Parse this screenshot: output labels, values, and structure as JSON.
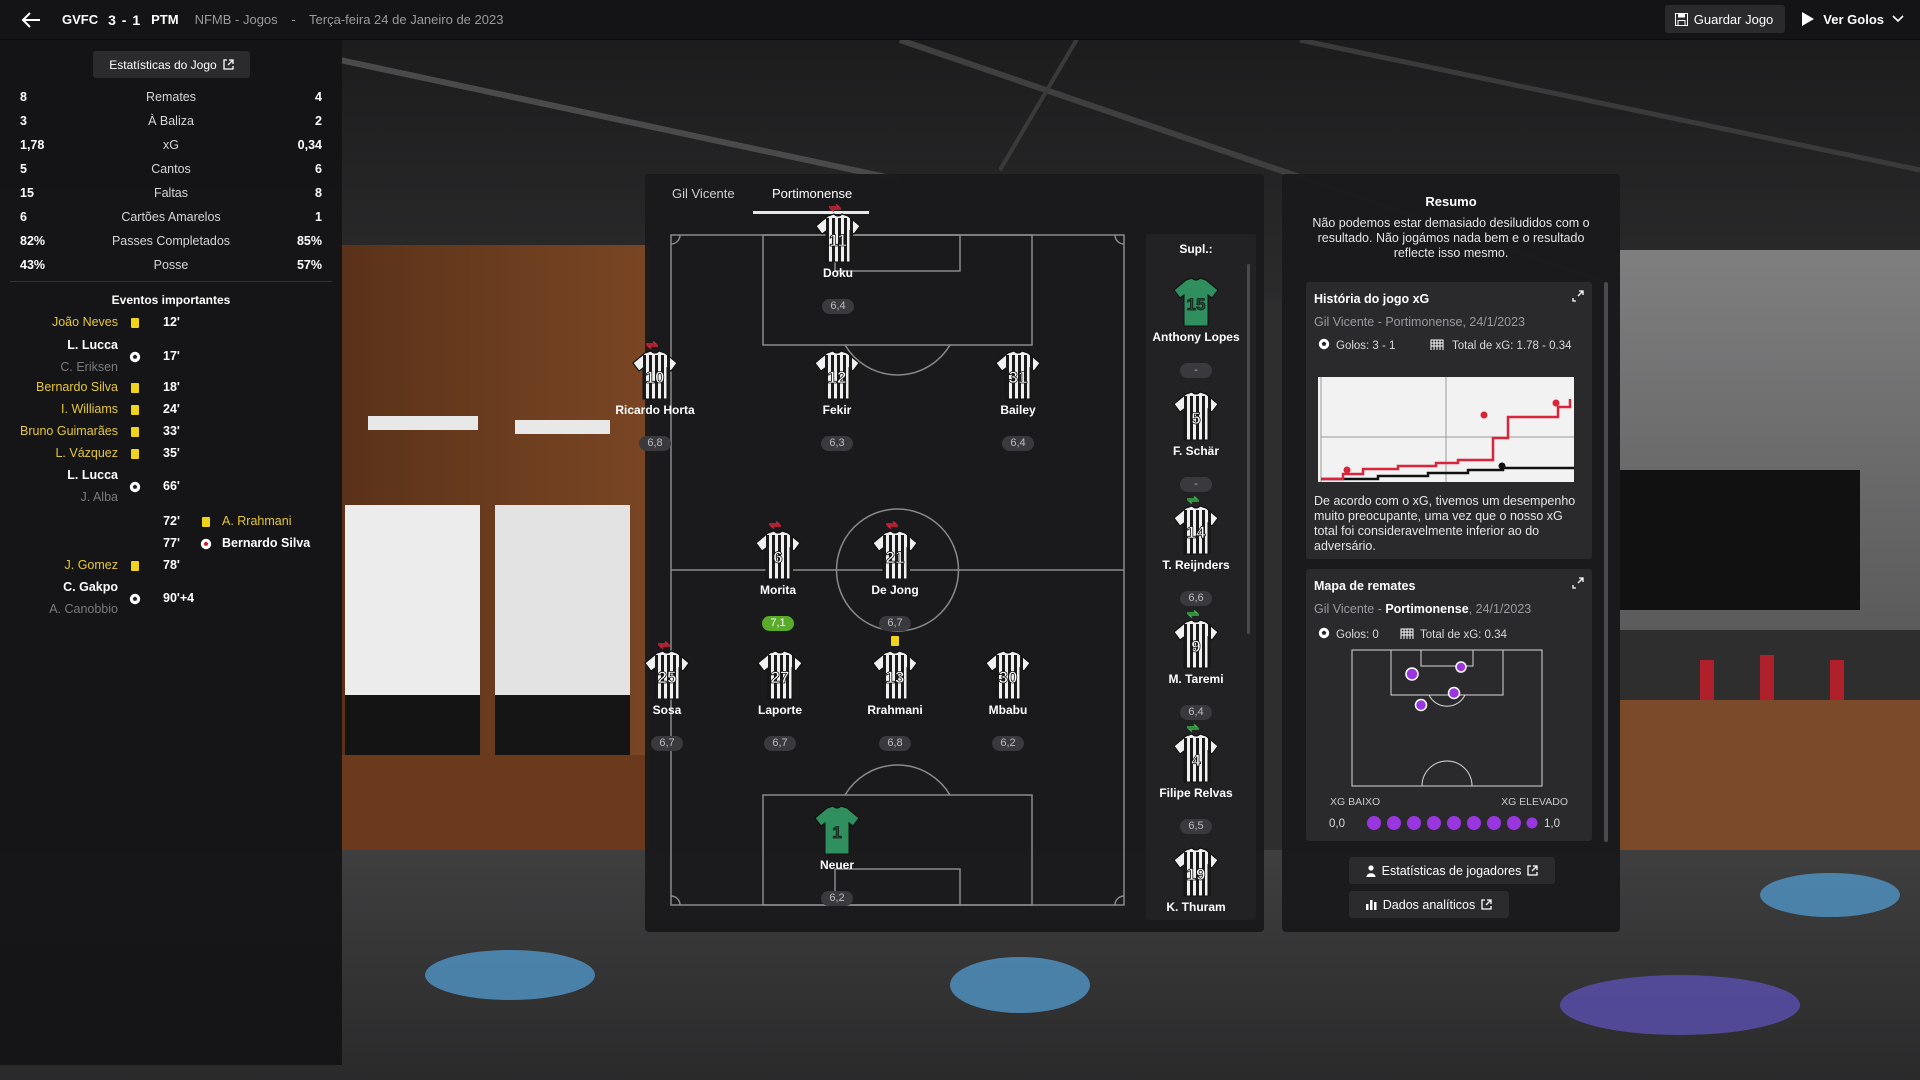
{
  "topbar": {
    "home_abbr": "GVFC",
    "score": "3 - 1",
    "away_abbr": "PTM",
    "competition": "NFMB - Jogos",
    "separator": "-",
    "date": "Terça-feira 24 de Janeiro de 2023",
    "save_label": "Guardar Jogo",
    "watch_label": "Ver Golos"
  },
  "left_panel": {
    "stats_button": "Estatísticas do Jogo",
    "stats": [
      {
        "home": "8",
        "label": "Remates",
        "away": "4"
      },
      {
        "home": "3",
        "label": "À Baliza",
        "away": "2"
      },
      {
        "home": "1,78",
        "label": "xG",
        "away": "0,34"
      },
      {
        "home": "5",
        "label": "Cantos",
        "away": "6"
      },
      {
        "home": "15",
        "label": "Faltas",
        "away": "8"
      },
      {
        "home": "6",
        "label": "Cartões Amarelos",
        "away": "1"
      },
      {
        "home": "82%",
        "label": "Passes Completados",
        "away": "85%"
      },
      {
        "home": "43%",
        "label": "Posse",
        "away": "57%"
      }
    ],
    "events_title": "Eventos importantes",
    "events": [
      {
        "player": "João Neves",
        "assist": "",
        "minute": "12'",
        "type": "yellow",
        "side": "home"
      },
      {
        "player": "L. Lucca",
        "assist": "C. Eriksen",
        "minute": "17'",
        "type": "goal",
        "side": "home"
      },
      {
        "player": "Bernardo Silva",
        "assist": "",
        "minute": "18'",
        "type": "yellow",
        "side": "home"
      },
      {
        "player": "I. Williams",
        "assist": "",
        "minute": "24'",
        "type": "yellow",
        "side": "home"
      },
      {
        "player": "Bruno Guimarães",
        "assist": "",
        "minute": "33'",
        "type": "yellow",
        "side": "home"
      },
      {
        "player": "L. Vázquez",
        "assist": "",
        "minute": "35'",
        "type": "yellow",
        "side": "home"
      },
      {
        "player": "L. Lucca",
        "assist": "J. Alba",
        "minute": "66'",
        "type": "goal",
        "side": "home"
      },
      {
        "player": "A. Rrahmani",
        "assist": "",
        "minute": "72'",
        "type": "yellow",
        "side": "away"
      },
      {
        "player": "Bernardo Silva",
        "assist": "",
        "minute": "77'",
        "type": "goal-red",
        "side": "away"
      },
      {
        "player": "J. Gomez",
        "assist": "",
        "minute": "78'",
        "type": "yellow",
        "side": "home"
      },
      {
        "player": "C. Gakpo",
        "assist": "A. Canobbio",
        "minute": "90'+4",
        "type": "goal",
        "side": "home"
      }
    ]
  },
  "pitch_panel": {
    "tabs": [
      "Gil Vicente",
      "Portimonense"
    ],
    "active_tab": 1,
    "players": [
      {
        "number": "11",
        "name": "Doku",
        "rating": "6,4",
        "keeper": false,
        "arrow": true,
        "top_rated": false,
        "booked": false
      },
      {
        "number": "10",
        "name": "Ricardo Horta",
        "rating": "6,8",
        "keeper": false,
        "arrow": true,
        "top_rated": false,
        "booked": false
      },
      {
        "number": "12",
        "name": "Fekir",
        "rating": "6,3",
        "keeper": false,
        "arrow": false,
        "top_rated": false,
        "booked": false
      },
      {
        "number": "31",
        "name": "Bailey",
        "rating": "6,4",
        "keeper": false,
        "arrow": false,
        "top_rated": false,
        "booked": false
      },
      {
        "number": "6",
        "name": "Morita",
        "rating": "7,1",
        "keeper": false,
        "arrow": true,
        "top_rated": true,
        "booked": false
      },
      {
        "number": "21",
        "name": "De Jong",
        "rating": "6,7",
        "keeper": false,
        "arrow": true,
        "top_rated": false,
        "booked": true
      },
      {
        "number": "25",
        "name": "Sosa",
        "rating": "6,7",
        "keeper": false,
        "arrow": true,
        "top_rated": false,
        "booked": false
      },
      {
        "number": "27",
        "name": "Laporte",
        "rating": "6,7",
        "keeper": false,
        "arrow": false,
        "top_rated": false,
        "booked": false
      },
      {
        "number": "13",
        "name": "Rrahmani",
        "rating": "6,8",
        "keeper": false,
        "arrow": false,
        "top_rated": false,
        "booked": false
      },
      {
        "number": "30",
        "name": "Mbabu",
        "rating": "6,2",
        "keeper": false,
        "arrow": false,
        "top_rated": false,
        "booked": false
      },
      {
        "number": "1",
        "name": "Neuer",
        "rating": "6,2",
        "keeper": true,
        "arrow": false,
        "top_rated": false,
        "booked": false
      }
    ],
    "subs_title": "Supl.:",
    "subs": [
      {
        "number": "15",
        "name": "Anthony Lopes",
        "rating": "-",
        "keeper": true,
        "arrow": false
      },
      {
        "number": "5",
        "name": "F. Schär",
        "rating": "-",
        "keeper": false,
        "arrow": false
      },
      {
        "number": "14",
        "name": "T. Reijnders",
        "rating": "6,6",
        "keeper": false,
        "arrow": true
      },
      {
        "number": "9",
        "name": "M. Taremi",
        "rating": "6,4",
        "keeper": false,
        "arrow": true
      },
      {
        "number": "4",
        "name": "Filipe Relvas",
        "rating": "6,5",
        "keeper": false,
        "arrow": true
      },
      {
        "number": "19",
        "name": "K. Thuram",
        "rating": "",
        "keeper": false,
        "arrow": false
      }
    ]
  },
  "summary": {
    "title": "Resumo",
    "text": "Não podemos estar demasiado desiludidos com o resultado. Não jogámos nada bem e o resultado reflecte isso mesmo.",
    "xg_card": {
      "title": "História do jogo xG",
      "subtitle": "Gil Vicente - Portimonense, 24/1/2023",
      "goals_label": "Golos: 3 - 1",
      "xg_label": "Total de xG: 1.78 - 0.34",
      "comment": "De acordo com o xG, tivemos um desempenho muito preocupante, uma vez que o nosso xG total foi consideravelmente inferior ao do adversário."
    },
    "shots_card": {
      "title": "Mapa de remates",
      "subtitle_home": "Gil Vicente",
      "subtitle_sep": " - ",
      "subtitle_away": "Portimonense",
      "subtitle_date": ", 24/1/2023",
      "goals_label": "Golos: 0",
      "xg_label": "Total de xG: 0.34",
      "low_label": "XG BAIXO",
      "high_label": "XG ELEVADO",
      "scale_min": "0,0",
      "scale_max": "1,0"
    },
    "player_stats_button": "Estatísticas de jogadores",
    "analytics_button": "Dados analíticos"
  },
  "colors": {
    "accent_yellow": "#e6c833",
    "rating_top": "#5aab2b",
    "xg_home": "#d9243a",
    "xg_away": "#111111",
    "shot_marker": "#9a36e0",
    "keeper_shirt": "#2f8f5e"
  }
}
